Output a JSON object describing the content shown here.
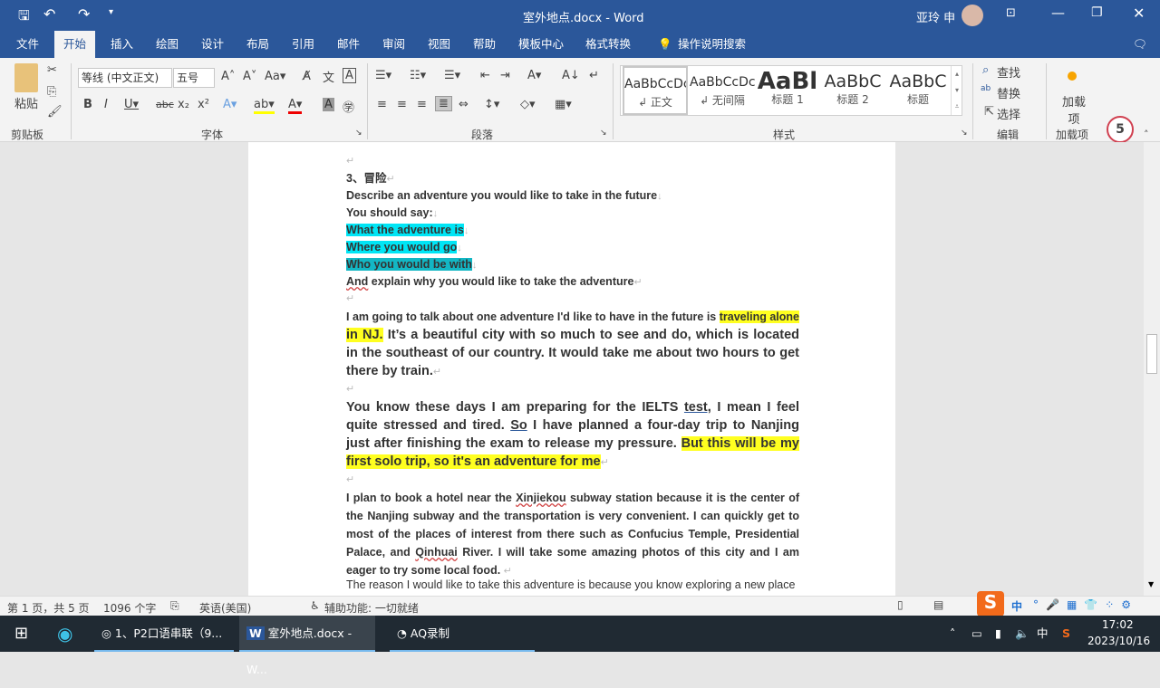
{
  "window": {
    "title": "室外地点.docx  -  Word",
    "user": "亚玲 申"
  },
  "tabs": [
    "文件",
    "开始",
    "插入",
    "绘图",
    "设计",
    "布局",
    "引用",
    "邮件",
    "审阅",
    "视图",
    "帮助",
    "模板中心",
    "格式转换"
  ],
  "search_label": "操作说明搜索",
  "ribbon": {
    "clipboard": {
      "paste": "粘贴",
      "label": "剪贴板"
    },
    "font": {
      "name": "等线 (中文正文)",
      "size": "五号",
      "label": "字体"
    },
    "paragraph": {
      "label": "段落"
    },
    "styles": {
      "label": "样式",
      "items": [
        {
          "preview": "AaBbCcDc",
          "name": "↲ 正文"
        },
        {
          "preview": "AaBbCcDc",
          "name": "↲ 无间隔"
        },
        {
          "preview": "AaBl",
          "name": "标题 1"
        },
        {
          "preview": "AaBbC",
          "name": "标题 2"
        },
        {
          "preview": "AaBbC",
          "name": "标题"
        }
      ]
    },
    "editing": {
      "find": "查找",
      "replace": "替换",
      "select": "选择",
      "label": "编辑"
    },
    "addins": {
      "button": "加载项",
      "label": "加载项"
    },
    "badge": "5"
  },
  "document": {
    "heading": "3、冒险",
    "prompt": "Describe an adventure you would like to take in the future",
    "say": "You should say:",
    "cues": [
      "What the adventure is",
      "Where you would go",
      "Who you would be with"
    ],
    "explain_a": "And",
    "explain_b": " explain why you would like to take the adventure",
    "p1": {
      "a": "I am going to talk about one adventure I'd like to have in the future is ",
      "hl1": "traveling alone",
      "hl2": "in NJ.",
      "b": " It’s a beautiful city with so much to see and do, which is located in the southeast of our country. It would take me about two hours to get there by train."
    },
    "p2": {
      "a": "You know these days I am preparing for the IELTS ",
      "u1": "test,",
      "b": " I mean I feel quite stressed and tired. ",
      "u2": "So",
      "c": " I have planned a four-day trip to Nanjing just after finishing the exam to release my pressure. ",
      "hl": "But this will be my first solo trip, so it's an adventure for me"
    },
    "p3": {
      "a": "I plan to book a hotel near the ",
      "w1": "Xinjiekou",
      "b": " subway station because it is the center of the Nanjing subway and the transportation is very convenient. I can quickly get to most of the places of interest from there such as Confucius Temple, Presidential Palace, and ",
      "w2": "Qinhuai",
      "c": " River. I will take some amazing photos of this city and I am eager to try some local food. "
    },
    "p4": "The reason I would like to take this adventure is because you know exploring a new place"
  },
  "status": {
    "page": "第 1 页，共 5 页",
    "words": "1096 个字",
    "lang": "英语(美国)",
    "access": "辅助功能: 一切就绪"
  },
  "taskbar": {
    "items": [
      "1、P2口语串联（9...",
      "室外地点.docx - W...",
      "AQ录制"
    ],
    "time": "17:02",
    "date": "2023/10/16",
    "ime": "中"
  },
  "colors": {
    "brand": "#2b579a",
    "cyan_highlight": "#00e5f5",
    "yellow_highlight": "#ffff20"
  }
}
